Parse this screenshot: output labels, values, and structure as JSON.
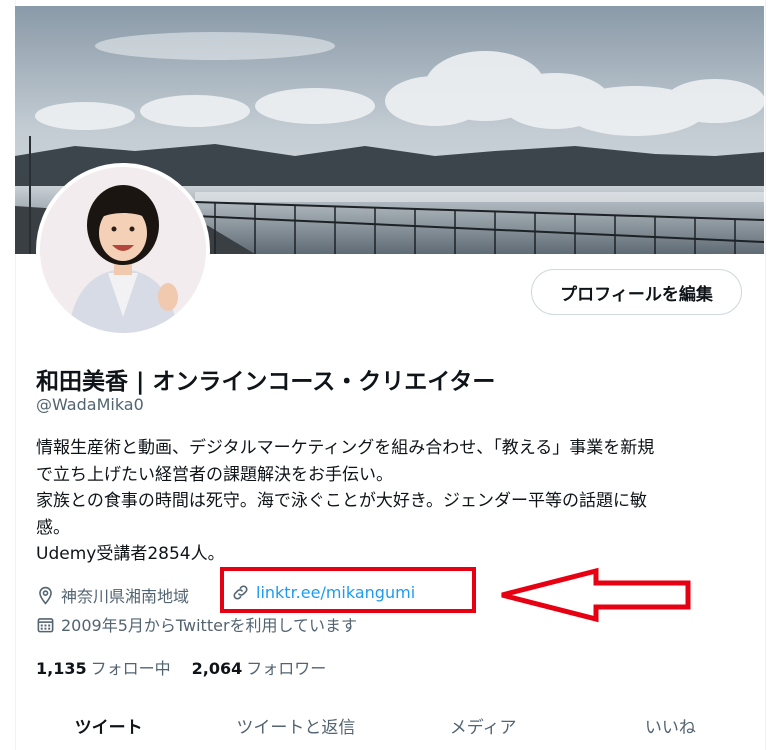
{
  "profile": {
    "name": "和田美香 | オンラインコース・クリエイター",
    "handle": "@WadaMika0",
    "edit_button": "プロフィールを編集",
    "bio_lines": [
      "情報生産術と動画、デジタルマーケティングを組み合わせ、「教える」事業を新規",
      "で立ち上げたい経営者の課題解決をお手伝い。",
      "家族との食事の時間は死守。海で泳ぐことが大好き。ジェンダー平等の話題に敏",
      "感。",
      "Udemy受講者2854人。"
    ],
    "location": "神奈川県湘南地域",
    "website": "linktr.ee/mikangumi",
    "joined": "2009年5月からTwitterを利用しています"
  },
  "stats": {
    "following_count": "1,135",
    "following_label": "フォロー中",
    "followers_count": "2,064",
    "followers_label": "フォロワー"
  },
  "tabs": [
    "ツイート",
    "ツイートと返信",
    "メディア",
    "いいね"
  ],
  "icons": {
    "location": "location-pin-icon",
    "link": "link-icon",
    "calendar": "calendar-icon"
  },
  "colors": {
    "accent": "#1d9bf0",
    "annotation": "#e60012",
    "text": "#0f1419",
    "secondary": "#536471"
  }
}
